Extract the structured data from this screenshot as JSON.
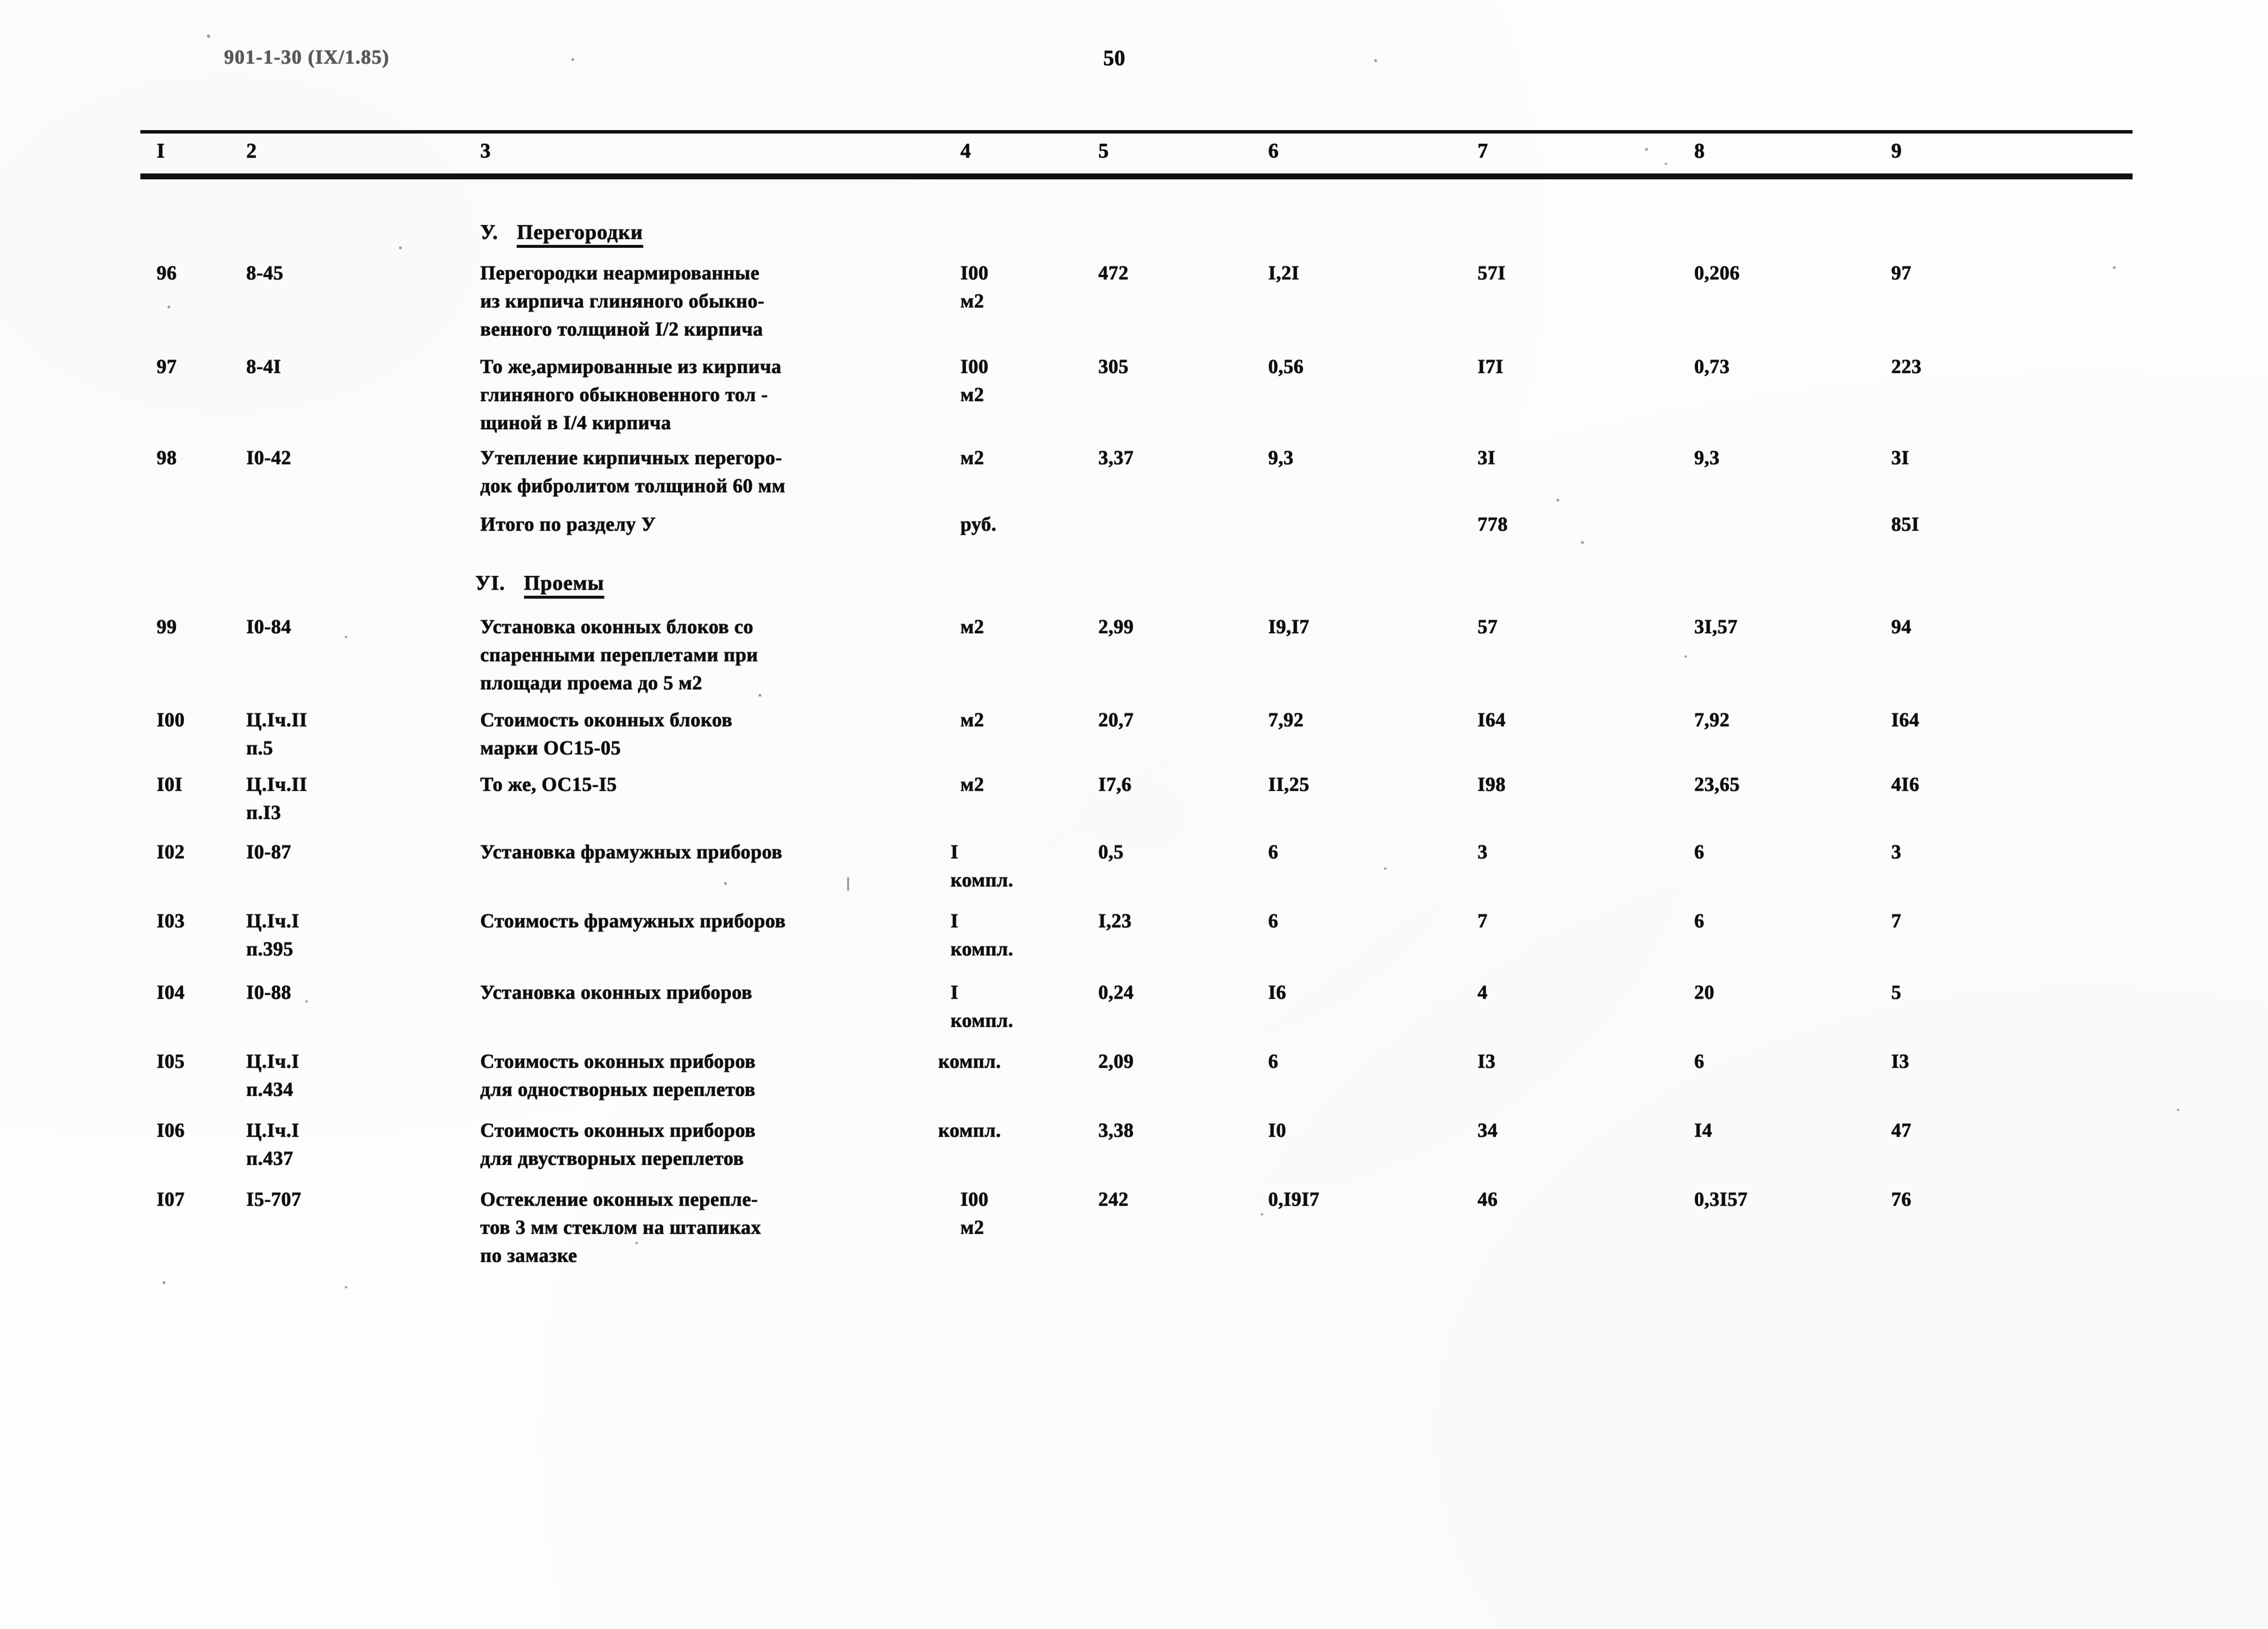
{
  "document": {
    "code": "901-1-30 (IX/1.85)",
    "page_number": "50"
  },
  "table": {
    "column_headers": [
      "I",
      "2",
      "3",
      "4",
      "5",
      "6",
      "7",
      "8",
      "9"
    ],
    "sections": [
      {
        "roman": "У.",
        "title": "Перегородки"
      },
      {
        "roman": "УI.",
        "title": "Проемы"
      }
    ],
    "rows": [
      {
        "no": "96",
        "code": "8-45",
        "name": "Перегородки неармированные\nиз кирпича глиняного обыкно-\nвенного толщиной I/2 кирпича",
        "unit": "I00\nм2",
        "c5": "472",
        "c6": "I,2I",
        "c7": "57I",
        "c8": "0,206",
        "c9": "97"
      },
      {
        "no": "97",
        "code": "8-4I",
        "name": "То же,армированные из кирпича\nглиняного обыкновенного тол -\nщиной в I/4 кирпича",
        "unit": "I00\nм2",
        "c5": "305",
        "c6": "0,56",
        "c7": "I7I",
        "c8": "0,73",
        "c9": "223"
      },
      {
        "no": "98",
        "code": "I0-42",
        "name": "Утепление кирпичных перегоро-\nдок фибролитом толщиной 60 мм",
        "unit": "м2",
        "c5": "3,37",
        "c6": "9,3",
        "c7": "3I",
        "c8": "9,3",
        "c9": "3I"
      },
      {
        "no": "",
        "code": "",
        "name": "Итого по разделу У",
        "unit": "руб.",
        "c5": "",
        "c6": "",
        "c7": "778",
        "c8": "",
        "c9": "85I"
      },
      {
        "no": "99",
        "code": "I0-84",
        "name": "Установка оконных блоков со\nспаренными переплетами при\nплощади проема до 5 м2",
        "unit": "м2",
        "c5": "2,99",
        "c6": "I9,I7",
        "c7": "57",
        "c8": "3I,57",
        "c9": "94"
      },
      {
        "no": "I00",
        "code": "Ц.Iч.II\nп.5",
        "name": "Стоимость оконных блоков\nмарки ОС15-05",
        "unit": "м2",
        "c5": "20,7",
        "c6": "7,92",
        "c7": "I64",
        "c8": "7,92",
        "c9": "I64"
      },
      {
        "no": "I0I",
        "code": "Ц.Iч.II\nп.I3",
        "name": "То же, ОС15-I5",
        "unit": "м2",
        "c5": "I7,6",
        "c6": "II,25",
        "c7": "I98",
        "c8": "23,65",
        "c9": "4I6"
      },
      {
        "no": "I02",
        "code": "I0-87",
        "name": "Установка фрамужных приборов",
        "unit": "I\nкомпл.",
        "c5": "0,5",
        "c6": "6",
        "c7": "3",
        "c8": "6",
        "c9": "3"
      },
      {
        "no": "I03",
        "code": "Ц.Iч.I\nп.395",
        "name": "Стоимость фрамужных приборов",
        "unit": "I\nкомпл.",
        "c5": "I,23",
        "c6": "6",
        "c7": "7",
        "c8": "6",
        "c9": "7"
      },
      {
        "no": "I04",
        "code": "I0-88",
        "name": "Установка оконных приборов",
        "unit": "I\nкомпл.",
        "c5": "0,24",
        "c6": "I6",
        "c7": "4",
        "c8": "20",
        "c9": "5"
      },
      {
        "no": "I05",
        "code": "Ц.Iч.I\nп.434",
        "name": "Стоимость оконных приборов\nдля одностворных переплетов",
        "unit": "компл.",
        "c5": "2,09",
        "c6": "6",
        "c7": "I3",
        "c8": "6",
        "c9": "I3"
      },
      {
        "no": "I06",
        "code": "Ц.Iч.I\nп.437",
        "name": "Стоимость оконных приборов\nдля двустворных переплетов",
        "unit": "компл.",
        "c5": "3,38",
        "c6": "I0",
        "c7": "34",
        "c8": "I4",
        "c9": "47"
      },
      {
        "no": "I07",
        "code": "I5-707",
        "name": "Остекление оконных перепле-\nтов 3 мм стеклом на штапиках\nпо замазке",
        "unit": "I00\nм2",
        "c5": "242",
        "c6": "0,I9I7",
        "c7": "46",
        "c8": "0,3I57",
        "c9": "76"
      }
    ]
  }
}
